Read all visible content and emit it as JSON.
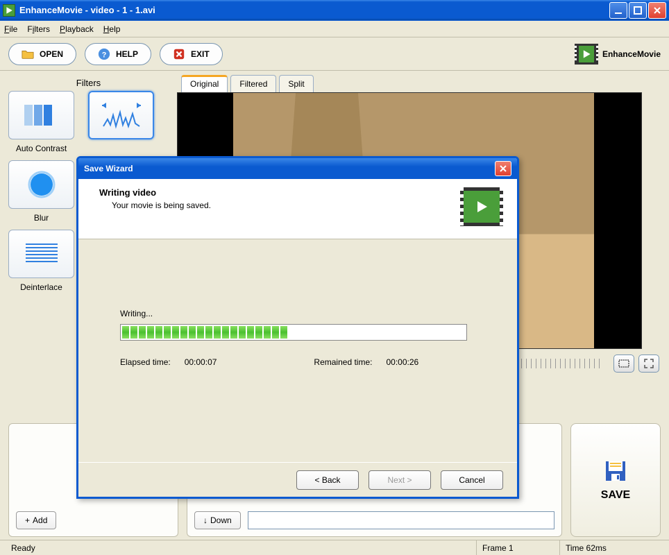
{
  "window": {
    "title": "EnhanceMovie - video - 1 - 1.avi"
  },
  "menu": {
    "file": "File",
    "filters": "Filters",
    "playback": "Playback",
    "help": "Help"
  },
  "toolbar": {
    "open": "OPEN",
    "help": "HELP",
    "exit": "EXIT"
  },
  "brand": "EnhanceMovie",
  "filters": {
    "header": "Filters",
    "items": [
      "Auto Contrast",
      "",
      "Blur",
      "Deinterlace"
    ]
  },
  "tabs": {
    "original": "Original",
    "filtered": "Filtered",
    "split": "Split"
  },
  "bottom": {
    "add": "Add",
    "down": "Down"
  },
  "save_button": "SAVE",
  "status": {
    "ready": "Ready",
    "frame": "Frame 1",
    "time": "Time 62ms"
  },
  "dialog": {
    "title": "Save Wizard",
    "heading": "Writing video",
    "sub": "Your movie is being saved.",
    "writing": "Writing...",
    "elapsed_label": "Elapsed time:",
    "elapsed_value": "00:00:07",
    "remained_label": "Remained time:",
    "remained_value": "00:00:26",
    "progress_segments": 20,
    "back": "< Back",
    "next": "Next >",
    "cancel": "Cancel"
  }
}
